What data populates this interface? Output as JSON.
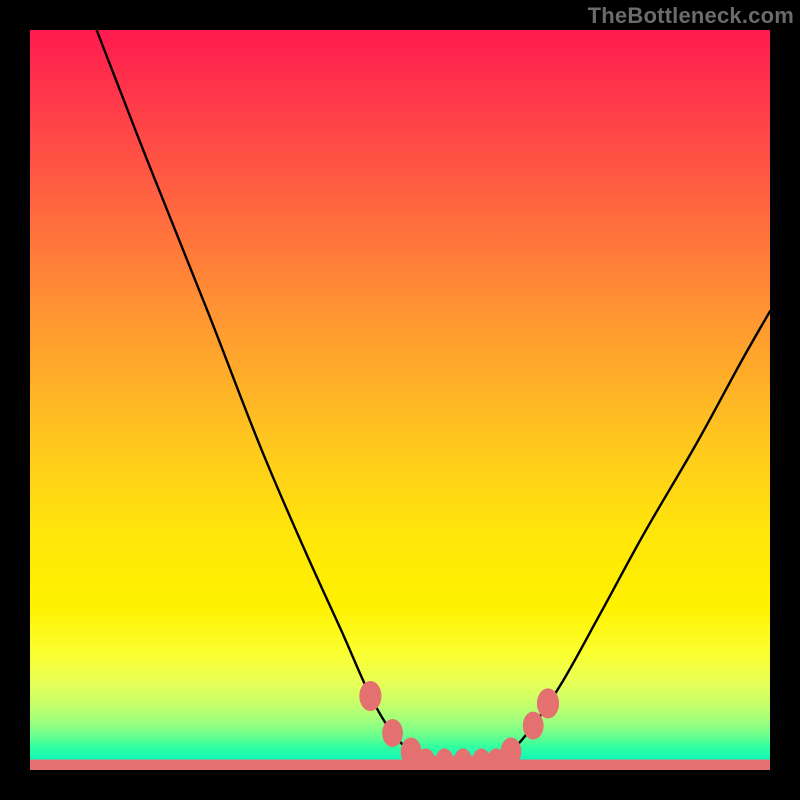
{
  "watermark": "TheBottleneck.com",
  "chart_data": {
    "type": "line",
    "title": "",
    "xlabel": "",
    "ylabel": "",
    "xlim": [
      0,
      100
    ],
    "ylim": [
      0,
      100
    ],
    "grid": false,
    "legend": false,
    "series": [
      {
        "name": "left-branch",
        "x": [
          9,
          16,
          24,
          31,
          37,
          42,
          46,
          49,
          51.5,
          53.5
        ],
        "y": [
          100,
          82,
          62,
          44,
          30,
          19,
          10,
          5,
          2.5,
          1.3
        ],
        "color": "#000000"
      },
      {
        "name": "right-branch",
        "x": [
          63,
          65,
          68,
          72,
          77,
          83,
          90,
          96,
          100
        ],
        "y": [
          1.3,
          2.5,
          6,
          12,
          21,
          32,
          44,
          55,
          62
        ],
        "color": "#000000"
      }
    ],
    "markers": [
      {
        "name": "left-marker-1",
        "x": 46.0,
        "y": 10.0,
        "r": 1.5
      },
      {
        "name": "left-marker-2",
        "x": 49.0,
        "y": 5.0,
        "r": 1.4
      },
      {
        "name": "left-marker-3",
        "x": 51.5,
        "y": 2.5,
        "r": 1.4
      },
      {
        "name": "flat-1",
        "x": 53.5,
        "y": 1.3,
        "r": 1.2
      },
      {
        "name": "flat-2",
        "x": 56.0,
        "y": 1.3,
        "r": 1.2
      },
      {
        "name": "flat-3",
        "x": 58.5,
        "y": 1.3,
        "r": 1.2
      },
      {
        "name": "flat-4",
        "x": 61.0,
        "y": 1.3,
        "r": 1.2
      },
      {
        "name": "flat-5",
        "x": 63.0,
        "y": 1.3,
        "r": 1.2
      },
      {
        "name": "right-marker-1",
        "x": 65.0,
        "y": 2.5,
        "r": 1.4
      },
      {
        "name": "right-marker-2",
        "x": 68.0,
        "y": 6.0,
        "r": 1.4
      },
      {
        "name": "right-marker-3",
        "x": 70.0,
        "y": 9.0,
        "r": 1.5
      }
    ],
    "marker_color": "#e47070",
    "bottom_band_color": "#e47070"
  }
}
